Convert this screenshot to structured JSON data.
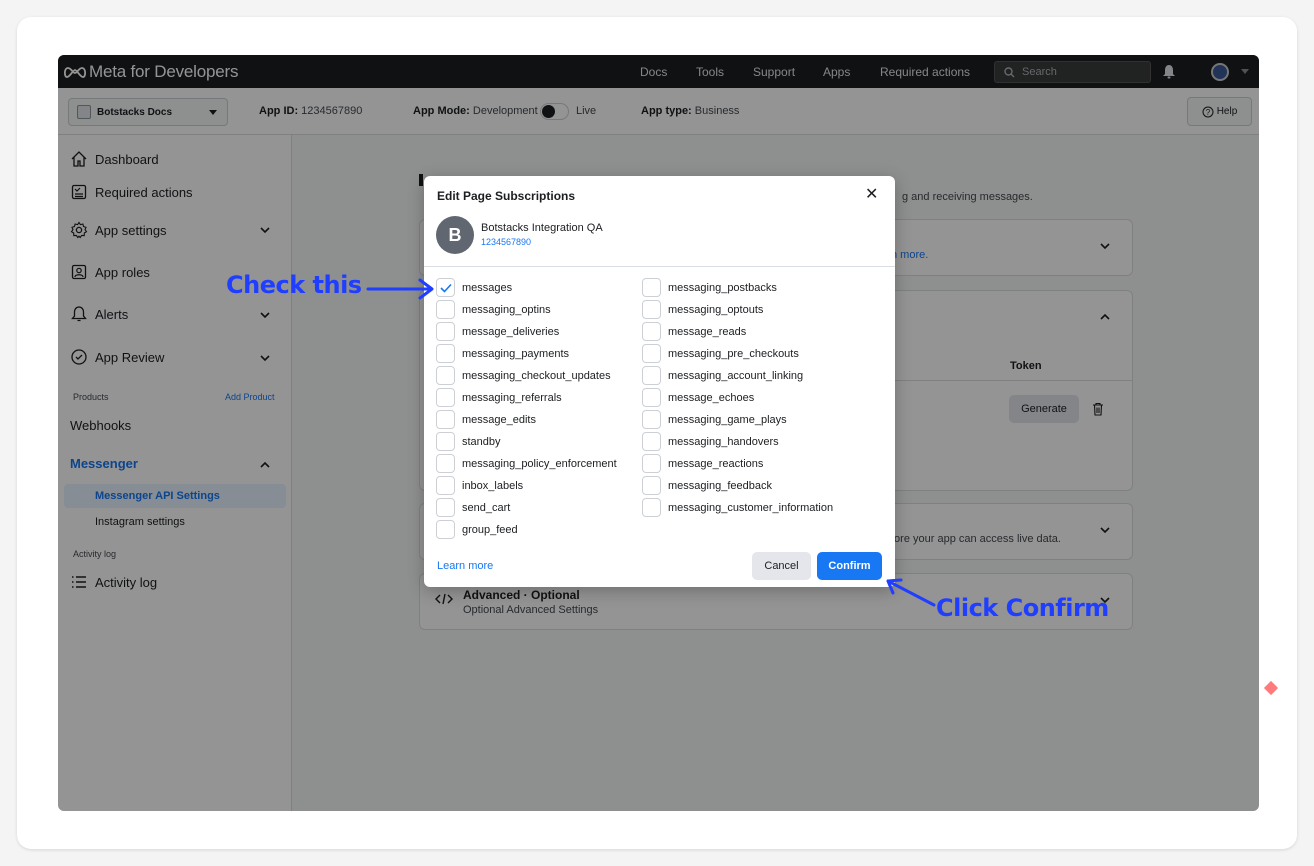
{
  "topnav": {
    "logo": "Meta for Developers",
    "links": [
      "Docs",
      "Tools",
      "Support",
      "Apps",
      "Required actions"
    ],
    "search_placeholder": "Search"
  },
  "subbar": {
    "app_name": "Botstacks Docs",
    "app_id_label": "App ID:",
    "app_id_value": "1234567890",
    "app_mode_label": "App Mode:",
    "app_mode_value": "Development",
    "live_label": "Live",
    "app_type_label": "App type:",
    "app_type_value": "Business",
    "help_label": "Help"
  },
  "sidebar": {
    "items": [
      {
        "label": "Dashboard",
        "icon": "home-icon"
      },
      {
        "label": "Required actions",
        "icon": "checklist-icon"
      },
      {
        "label": "App settings",
        "icon": "gear-icon"
      },
      {
        "label": "App roles",
        "icon": "id-card-icon"
      },
      {
        "label": "Alerts",
        "icon": "bell-icon"
      },
      {
        "label": "App Review",
        "icon": "shield-check-icon"
      }
    ],
    "products_label": "Products",
    "add_product": "Add Product",
    "webhooks": "Webhooks",
    "messenger": "Messenger",
    "messenger_api_settings": "Messenger API Settings",
    "instagram_settings": "Instagram settings",
    "activity_section": "Activity log",
    "activity_item": "Activity log"
  },
  "main": {
    "bg_line1": "g and receiving messages.",
    "bg_more": "n more.",
    "token_header": "Token",
    "generate_button": "Generate",
    "live_data_text": "fore your app can access live data.",
    "advanced_title": "Advanced · Optional",
    "advanced_sub": "Optional Advanced Settings"
  },
  "modal": {
    "title": "Edit Page Subscriptions",
    "page_initial": "B",
    "page_name": "Botstacks Integration QA",
    "page_id": "1234567890",
    "left_fields": [
      {
        "label": "messages",
        "checked": true
      },
      {
        "label": "messaging_optins",
        "checked": false
      },
      {
        "label": "message_deliveries",
        "checked": false
      },
      {
        "label": "messaging_payments",
        "checked": false
      },
      {
        "label": "messaging_checkout_updates",
        "checked": false
      },
      {
        "label": "messaging_referrals",
        "checked": false
      },
      {
        "label": "message_edits",
        "checked": false
      },
      {
        "label": "standby",
        "checked": false
      },
      {
        "label": "messaging_policy_enforcement",
        "checked": false
      },
      {
        "label": "inbox_labels",
        "checked": false
      },
      {
        "label": "send_cart",
        "checked": false
      },
      {
        "label": "group_feed",
        "checked": false
      }
    ],
    "right_fields": [
      {
        "label": "messaging_postbacks",
        "checked": false
      },
      {
        "label": "messaging_optouts",
        "checked": false
      },
      {
        "label": "message_reads",
        "checked": false
      },
      {
        "label": "messaging_pre_checkouts",
        "checked": false
      },
      {
        "label": "messaging_account_linking",
        "checked": false
      },
      {
        "label": "message_echoes",
        "checked": false
      },
      {
        "label": "messaging_game_plays",
        "checked": false
      },
      {
        "label": "messaging_handovers",
        "checked": false
      },
      {
        "label": "message_reactions",
        "checked": false
      },
      {
        "label": "messaging_feedback",
        "checked": false
      },
      {
        "label": "messaging_customer_information",
        "checked": false
      }
    ],
    "learn_more": "Learn more",
    "cancel": "Cancel",
    "confirm": "Confirm"
  },
  "annotations": {
    "check_this": "Check this",
    "click_confirm": "Click Confirm",
    "color": "#1f3eff"
  }
}
